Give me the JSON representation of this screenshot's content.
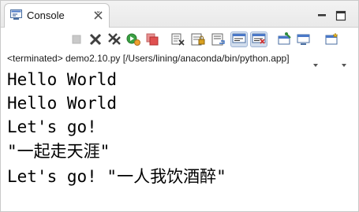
{
  "tab": {
    "label": "Console",
    "icon": "console-icon"
  },
  "window_controls": {
    "minimize_icon": "minimize-icon",
    "maximize_icon": "maximize-icon"
  },
  "toolbar": {
    "buttons": [
      "terminate-icon",
      "remove-launch-icon",
      "remove-all-terminated-icon",
      "relaunch-icon",
      "stop-all-icon",
      "clear-console-icon",
      "scroll-lock-icon",
      "word-wrap-icon",
      "show-on-stdout-icon",
      "show-on-stderr-icon",
      "pin-console-icon",
      "display-console-icon",
      "open-console-icon"
    ]
  },
  "status": "<terminated> demo2.10.py [/Users/lining/anaconda/bin/python.app]",
  "output": {
    "lines": [
      "Hello World",
      "Hello World",
      "Let's go!",
      "\"一起走天涯\"",
      "Let's go! \"一人我饮酒醉\""
    ]
  }
}
